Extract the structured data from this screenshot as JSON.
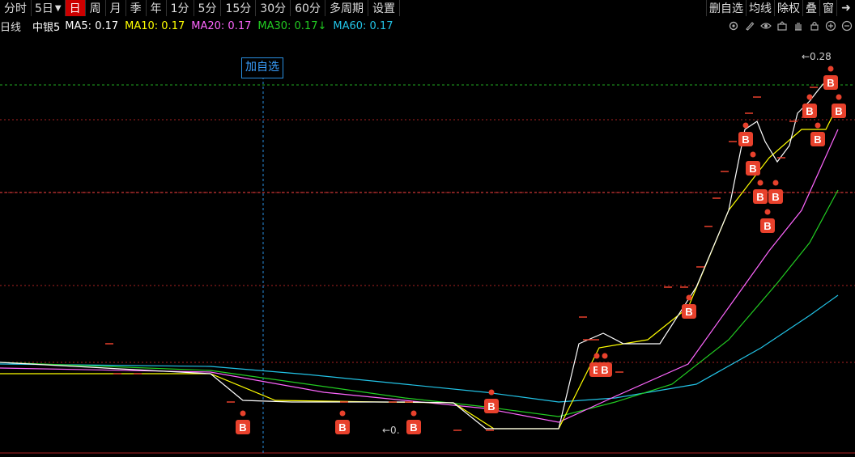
{
  "toolbar": {
    "left": [
      "分时",
      "5日",
      "日",
      "周",
      "月",
      "季",
      "年",
      "1分",
      "5分",
      "15分",
      "30分",
      "60分",
      "多周期",
      "设置"
    ],
    "active": "日",
    "right": [
      "删自选",
      "均线",
      "除权",
      "叠",
      "窗"
    ]
  },
  "info": {
    "period": "日线",
    "name": "中银5",
    "ma5": "MA5: 0.17",
    "ma10": "MA10: 0.17",
    "ma20": "MA20: 0.17",
    "ma30": "MA30: 0.17↓",
    "ma60": "MA60: 0.17",
    "icons": [
      "settings-icon",
      "pen-icon",
      "eye-icon",
      "basket-icon",
      "hand-icon",
      "lock-icon",
      "zoom-in-icon",
      "zoom-out-icon"
    ]
  },
  "chart": {
    "add_label": "加自选",
    "high_label": "←0.28",
    "low_label": "←0.",
    "marker_label": "B",
    "colors": {
      "ma5": "#ffffff",
      "ma10": "#ffff00",
      "ma20": "#ff66ff",
      "ma30": "#22cc22",
      "ma60": "#22c3e6",
      "grid": "#aa2222",
      "marker": "#e8412c"
    }
  }
}
